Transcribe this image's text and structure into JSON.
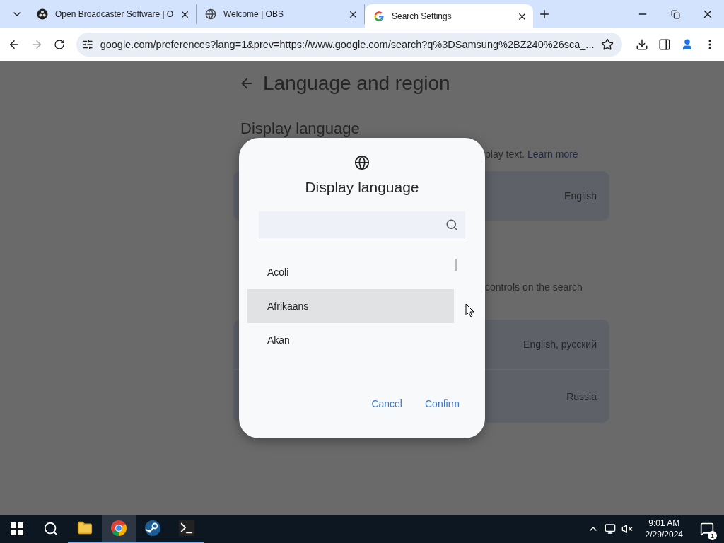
{
  "tabs": [
    {
      "title": "Open Broadcaster Software | O",
      "selected": false
    },
    {
      "title": "Welcome | OBS",
      "selected": false
    },
    {
      "title": "Search Settings",
      "selected": true
    }
  ],
  "address": "google.com/preferences?lang=1&prev=https://www.google.com/search?q%3DSamsung%2BZ240%26sca_...",
  "page": {
    "title": "Language and region",
    "heading": "Display language",
    "description_fragment": "play text.",
    "link": "Learn more",
    "card_1": "English",
    "fragment_2": "controls on the search",
    "card_2": "English, русский",
    "card_3": "Russia"
  },
  "dialog": {
    "title": "Display language",
    "languages": [
      {
        "name": "Acoli",
        "selected": false
      },
      {
        "name": "Afrikaans",
        "selected": true
      },
      {
        "name": "Akan",
        "selected": false
      }
    ],
    "buttons": [
      "Cancel",
      "Confirm"
    ]
  },
  "taskbar": {
    "apps": [
      {
        "kind": "folder",
        "selected": false
      },
      {
        "kind": "chrome",
        "selected": true
      },
      {
        "kind": "steam",
        "selected": false
      },
      {
        "kind": "terminal",
        "selected": false
      }
    ],
    "time": "9:01 AM",
    "date": "2/29/2024",
    "notifications": "1"
  }
}
